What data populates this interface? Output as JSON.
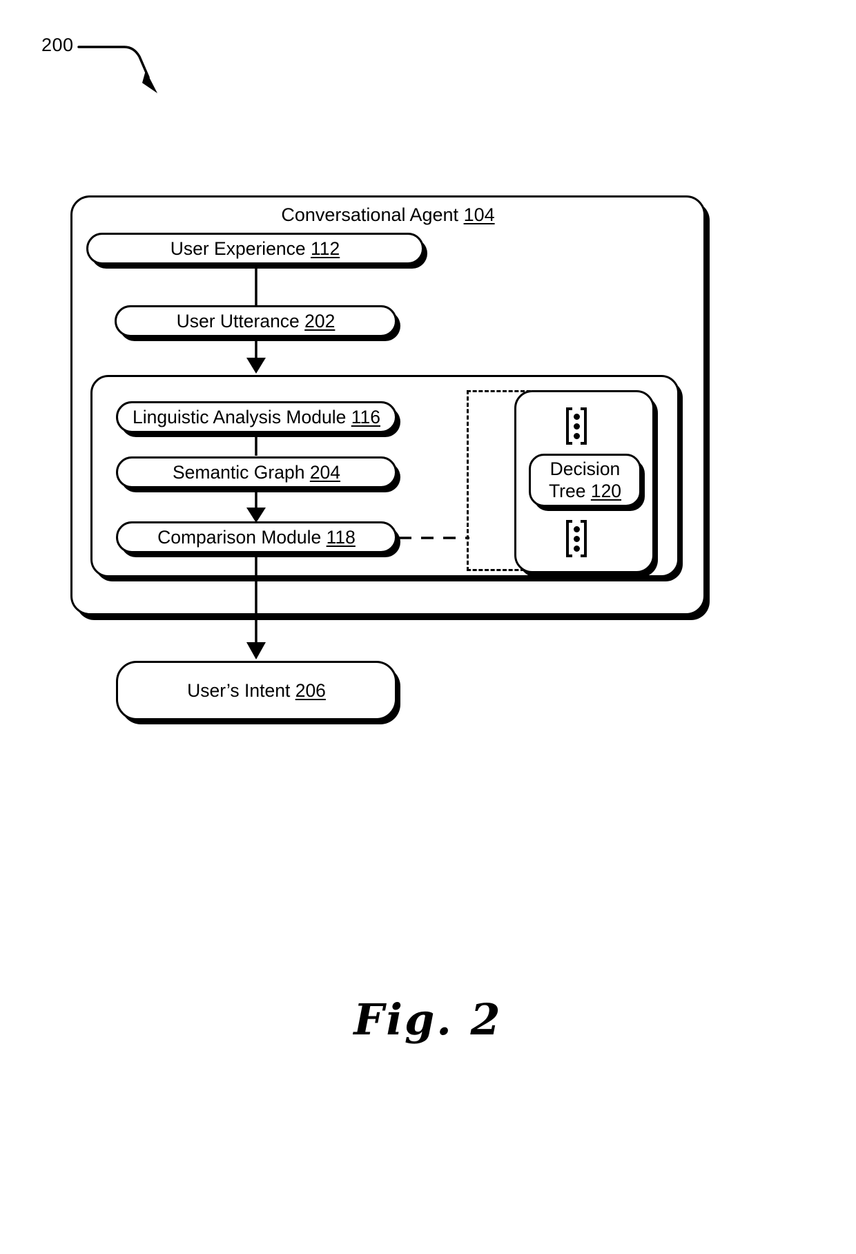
{
  "figure": {
    "reference_numeral": "200",
    "caption": "Fig. 2",
    "leader_icon": "curved-arrow-icon"
  },
  "outer_container": {
    "title_text": "Conversational Agent",
    "title_ref": "104"
  },
  "nodes": [
    {
      "id": "user-experience",
      "text": "User Experience",
      "ref": "112"
    },
    {
      "id": "user-utterance",
      "text": "User Utterance",
      "ref": "202"
    },
    {
      "id": "linguistic-analysis",
      "text": "Linguistic Analysis  Module",
      "ref": "116"
    },
    {
      "id": "semantic-graph",
      "text": "Semantic Graph",
      "ref": "204"
    },
    {
      "id": "comparison-module",
      "text": "Comparison Module",
      "ref": "118"
    },
    {
      "id": "users-intent",
      "text": "User’s Intent",
      "ref": "206"
    },
    {
      "id": "decision-tree",
      "text": "Decision Tree",
      "ref": "120",
      "text_line1": "Decision",
      "text_line2": "Tree"
    }
  ],
  "icons": {
    "vertical_ellipsis_top": "vertical-ellipsis-icon",
    "vertical_ellipsis_bottom": "vertical-ellipsis-icon"
  },
  "connectors": [
    {
      "from": "user-experience",
      "to": "user-utterance",
      "style": "solid",
      "arrowhead": "none"
    },
    {
      "from": "user-utterance",
      "to": "linguistic-analysis",
      "style": "solid",
      "arrowhead": "down"
    },
    {
      "from": "linguistic-analysis",
      "to": "semantic-graph",
      "style": "solid",
      "arrowhead": "none"
    },
    {
      "from": "semantic-graph",
      "to": "comparison-module",
      "style": "solid",
      "arrowhead": "down"
    },
    {
      "from": "comparison-module",
      "to": "users-intent",
      "style": "solid",
      "arrowhead": "down"
    },
    {
      "from": "comparison-module",
      "to": "decision-tree-group",
      "style": "dashed",
      "arrowhead": "none"
    }
  ],
  "colors": {
    "stroke": "#000000",
    "background": "#ffffff"
  }
}
